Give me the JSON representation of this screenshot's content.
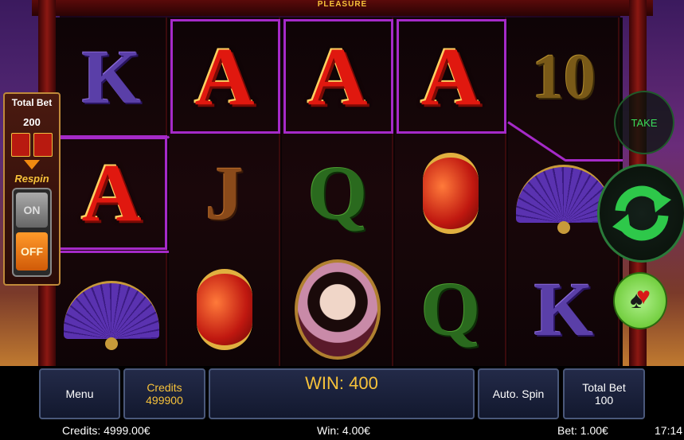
{
  "game": {
    "logo": "PLEASURE"
  },
  "reels": [
    [
      {
        "symbol": "K",
        "type": "letter-k"
      },
      {
        "symbol": "A",
        "type": "letter-a",
        "highlighted": true
      },
      {
        "symbol": "fan",
        "type": "fan"
      }
    ],
    [
      {
        "symbol": "A",
        "type": "letter-a",
        "highlighted": true
      },
      {
        "symbol": "J",
        "type": "letter-j"
      },
      {
        "symbol": "lantern",
        "type": "lantern"
      }
    ],
    [
      {
        "symbol": "A",
        "type": "letter-a",
        "highlighted": true
      },
      {
        "symbol": "Q",
        "type": "letter-q"
      },
      {
        "symbol": "geisha",
        "type": "geisha"
      }
    ],
    [
      {
        "symbol": "A",
        "type": "letter-a",
        "highlighted": true
      },
      {
        "symbol": "lantern",
        "type": "lantern"
      },
      {
        "symbol": "Q",
        "type": "letter-q"
      }
    ],
    [
      {
        "symbol": "10",
        "type": "letter-10"
      },
      {
        "symbol": "fan",
        "type": "fan"
      },
      {
        "symbol": "K",
        "type": "letter-k"
      }
    ]
  ],
  "left_panel": {
    "total_bet_label": "Total Bet",
    "total_bet_value": "200",
    "respin_label": "Respin",
    "on_label": "ON",
    "off_label": "OFF"
  },
  "right_panel": {
    "take_label": "TAKE",
    "spin_icon": "refresh-arrows-icon",
    "gamble_icon": "card-suits-icon"
  },
  "bottom": {
    "menu_label": "Menu",
    "credits_label": "Credits",
    "credits_value": "499900",
    "win_label": "WIN: 400",
    "autospin_label": "Auto. Spin",
    "total_bet_label": "Total Bet",
    "total_bet_value": "100"
  },
  "status": {
    "credits": "Credits: 4999.00€",
    "win": "Win: 4.00€",
    "bet": "Bet: 1.00€",
    "time": "17:14"
  },
  "colors": {
    "payline": "#a52ac8",
    "gold": "#f7c23a",
    "spin_green": "#2ec84a"
  }
}
